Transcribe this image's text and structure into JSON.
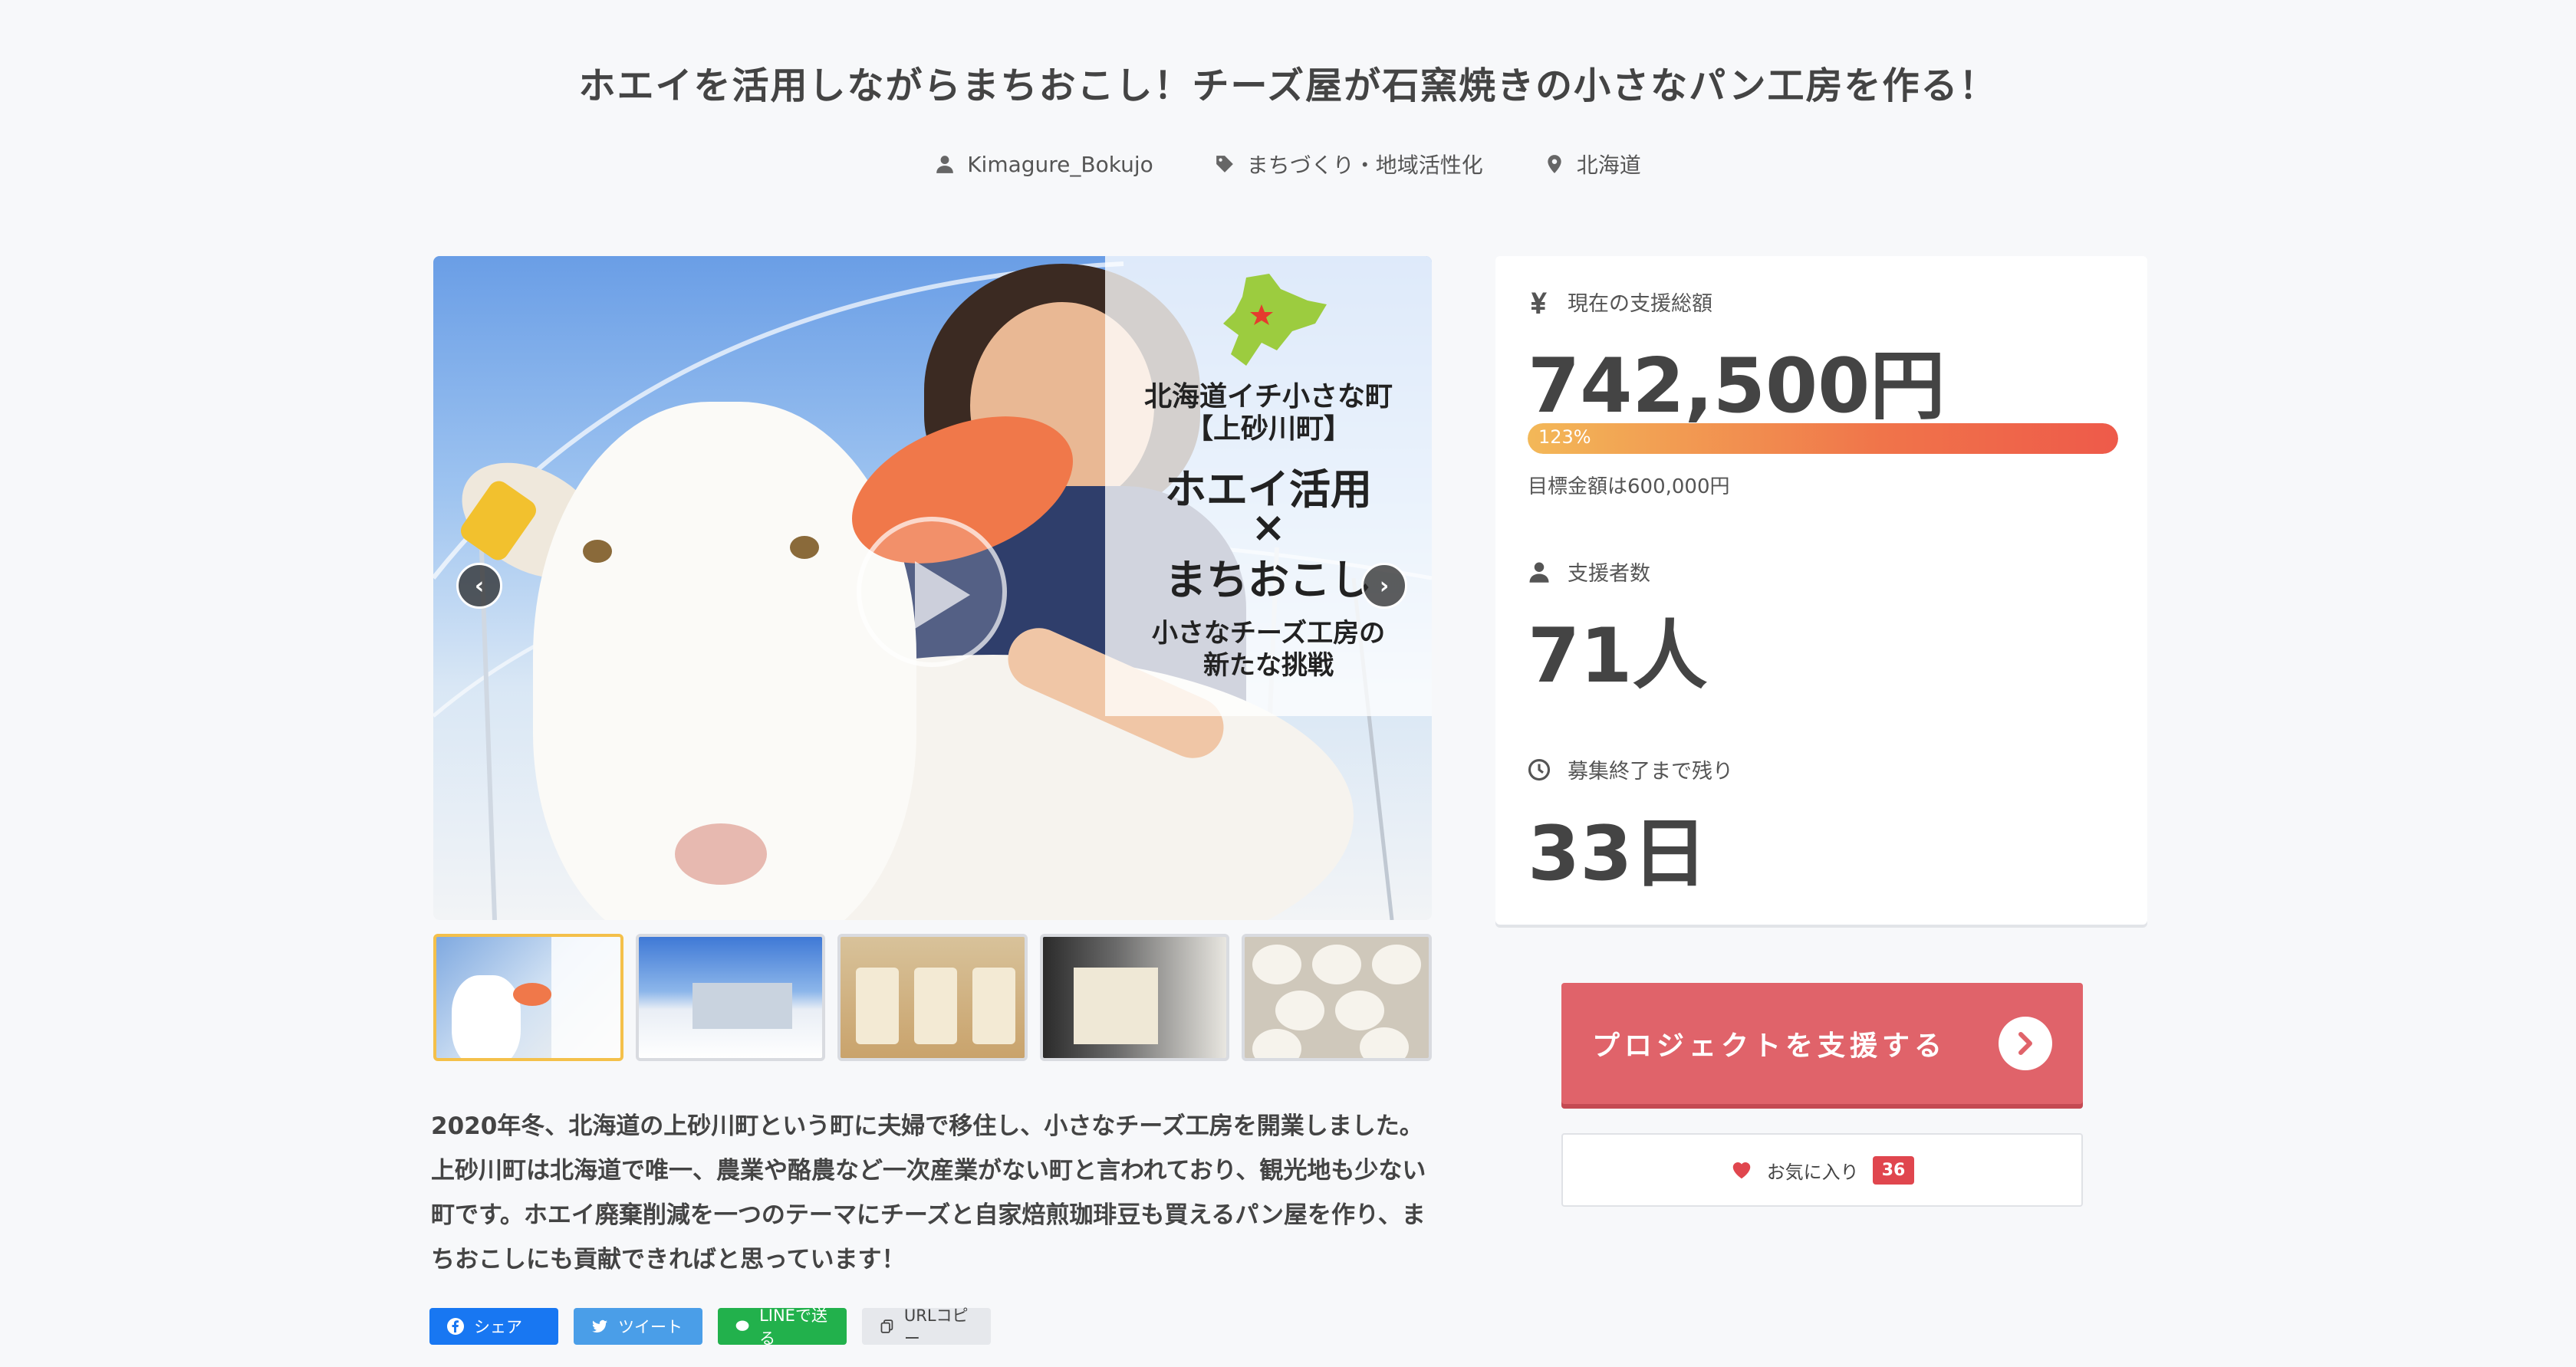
{
  "project": {
    "title": "ホエイを活用しながらまちおこし！チーズ屋が石窯焼きの小さなパン工房を作る！",
    "owner": "Kimagure_Bokujo",
    "category": "まちづくり・地域活性化",
    "location": "北海道"
  },
  "hero": {
    "overlay_lines": [
      "北海道イチ小さな町",
      "【上砂川町】",
      "ホエイ活用",
      "×",
      "まちおこし",
      "小さなチーズ工房の",
      "新たな挑戦"
    ],
    "prev_icon": "chevron-left-icon",
    "next_icon": "chevron-right-icon",
    "play_icon": "play-icon"
  },
  "thumbnails": [
    {
      "active": true
    },
    {
      "active": false
    },
    {
      "active": false
    },
    {
      "active": false
    },
    {
      "active": false
    }
  ],
  "description": "2020年冬、北海道の上砂川町という町に夫婦で移住し、小さなチーズ工房を開業しました。上砂川町は北海道で唯一、農業や酪農など一次産業がない町と言われており、観光地も少ない町です。ホエイ廃棄削減を一つのテーマにチーズと自家焙煎珈琲豆も買えるパン屋を作り、まちおこしにも貢献できればと思っています！",
  "share": {
    "facebook": "シェア",
    "twitter": "ツイート",
    "line": "LINEで送る",
    "copy": "URLコピー"
  },
  "stats": {
    "amount_label": "現在の支援総額",
    "amount_value": "742,500円",
    "progress_percent": 123,
    "progress_label": "123%",
    "goal_text": "目標金額は600,000円",
    "supporters_label": "支援者数",
    "supporters_value": "71人",
    "remaining_label": "募集終了まで残り",
    "remaining_value": "33日"
  },
  "actions": {
    "support_label": "プロジェクトを支援する",
    "favorite_label": "お気に入り",
    "favorite_count": "36"
  },
  "colors": {
    "accent": "#e0636a",
    "progress_start": "#f3b858",
    "progress_end": "#ee5a4a",
    "badge": "#e0464e"
  }
}
